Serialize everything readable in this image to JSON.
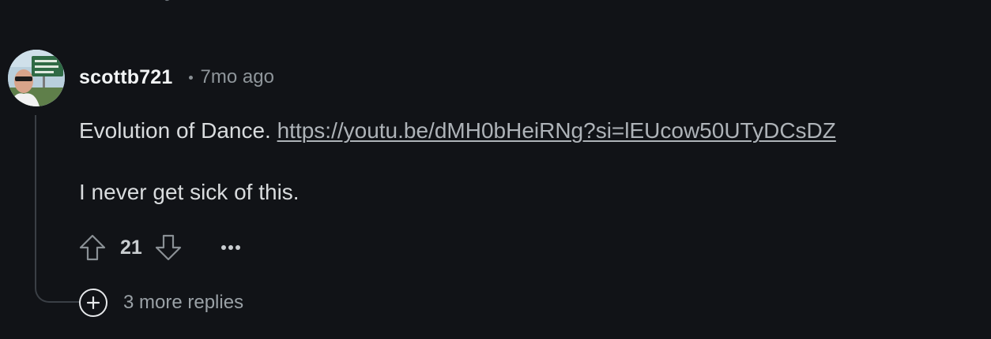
{
  "comment": {
    "username": "scottb721",
    "time": "7mo ago",
    "text_line1": "Evolution of Dance.",
    "link": "https://youtu.be/dMH0bHeiRNg?si=lEUcow50UTyDCsDZ",
    "text_line2": "I never get sick of this.",
    "score": "21",
    "replies_label": "3 more replies"
  },
  "icons": {
    "upvote": "arrow-up-outline",
    "downvote": "arrow-down-outline",
    "more": "ellipsis",
    "expand": "plus-circle"
  },
  "colors": {
    "background": "#111317",
    "text": "#d9dcde",
    "muted": "#8f969b",
    "link": "#aeb3b8"
  }
}
